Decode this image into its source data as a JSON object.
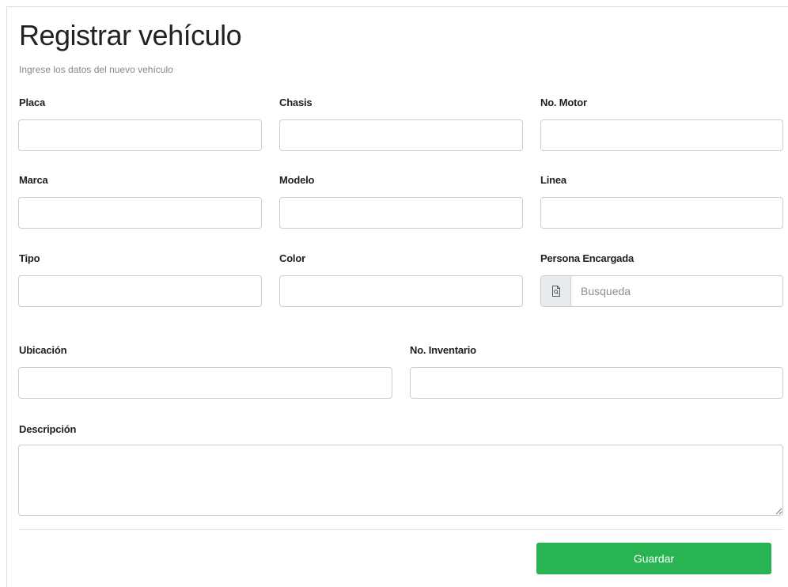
{
  "header": {
    "title": "Registrar vehículo",
    "subtitle": "Ingrese los datos del nuevo vehículo"
  },
  "fields": {
    "placa": {
      "label": "Placa",
      "value": ""
    },
    "chasis": {
      "label": "Chasis",
      "value": ""
    },
    "motor": {
      "label": "No. Motor",
      "value": ""
    },
    "marca": {
      "label": "Marca",
      "value": ""
    },
    "modelo": {
      "label": "Modelo",
      "value": ""
    },
    "linea": {
      "label": "Linea",
      "value": ""
    },
    "tipo": {
      "label": "Tipo",
      "value": ""
    },
    "color": {
      "label": "Color",
      "value": ""
    },
    "persona": {
      "label": "Persona Encargada",
      "placeholder": "Busqueda",
      "icon": "search-document-icon",
      "value": ""
    },
    "ubicacion": {
      "label": "Ubicación",
      "value": ""
    },
    "inventario": {
      "label": "No. Inventario",
      "value": ""
    },
    "descripcion": {
      "label": "Descripción",
      "value": ""
    }
  },
  "actions": {
    "save_label": "Guardar",
    "save_color": "#28b452"
  }
}
